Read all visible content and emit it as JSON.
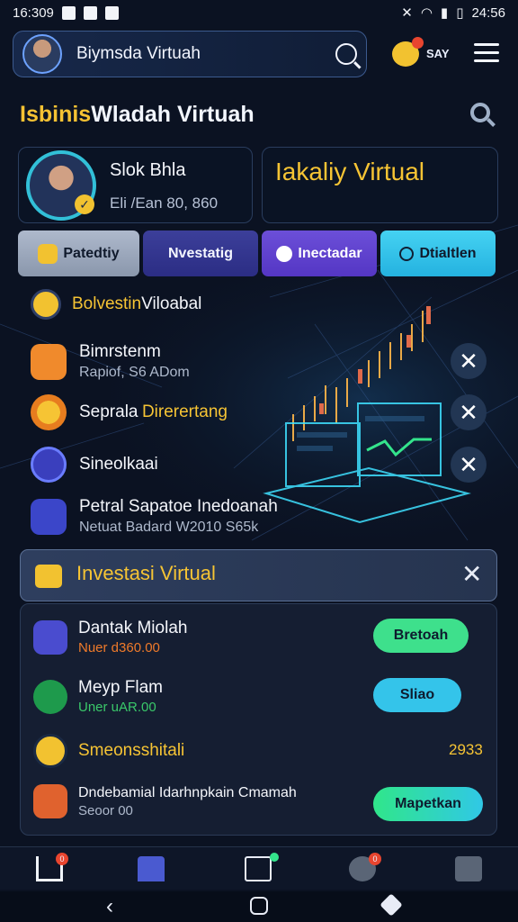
{
  "status_bar": {
    "time": "16:309",
    "clock": "24:56"
  },
  "header": {
    "app_title": "Biymsda Virtuah",
    "say_label": "SAY"
  },
  "page": {
    "title_part1": "Isbinis",
    "title_part2": "Wladah Virtuah"
  },
  "profile": {
    "name": "Slok Bhla",
    "subtitle": "Eli /Ean 80, 860"
  },
  "virtual_card": {
    "title": "Iakaliy Virtual"
  },
  "tabs": [
    {
      "label": "Patedtiy"
    },
    {
      "label": "Nvestatig"
    },
    {
      "label": "Inectadar"
    },
    {
      "label": "Dtialtlen"
    }
  ],
  "list": {
    "header": {
      "part1": "Bolvestin",
      "part2": "Viloabal"
    },
    "items": [
      {
        "title": "Bimrstenm",
        "subtitle": "Rapiof, S6 ADom"
      },
      {
        "title_part1": "Seprala",
        "title_part2": "Direrertang"
      },
      {
        "title": "Sineolkaai"
      },
      {
        "title": "Petral Sapatoe Inedoanah",
        "subtitle": "Netuat Badard W2010 S65k"
      }
    ]
  },
  "banner": {
    "title": "Investasi Virtual",
    "close": "✕"
  },
  "panel": {
    "rows": [
      {
        "title": "Dantak Miolah",
        "subtitle": "Nuer d360.00",
        "button": "Bretoah"
      },
      {
        "title": "Meyp Flam",
        "subtitle": "Uner uAR.00",
        "button": "Sliao"
      },
      {
        "title": "Smeonsshitali",
        "value": "2933"
      },
      {
        "title": "Dndebamial Idarhnpkain Cmamah",
        "subtitle": "Seoor 00",
        "button": "Mapetkan"
      }
    ]
  },
  "nav_badges": [
    "0",
    "0"
  ],
  "colors": {
    "accent_yellow": "#f6c434",
    "accent_cyan": "#34c4ea",
    "accent_green": "#2fe48c",
    "background": "#0b1222"
  },
  "icons": [
    "search-icon",
    "bell-icon",
    "menu-icon",
    "home-icon",
    "bank-icon",
    "wallet-icon",
    "users-icon",
    "briefcase-icon",
    "close-icon"
  ]
}
